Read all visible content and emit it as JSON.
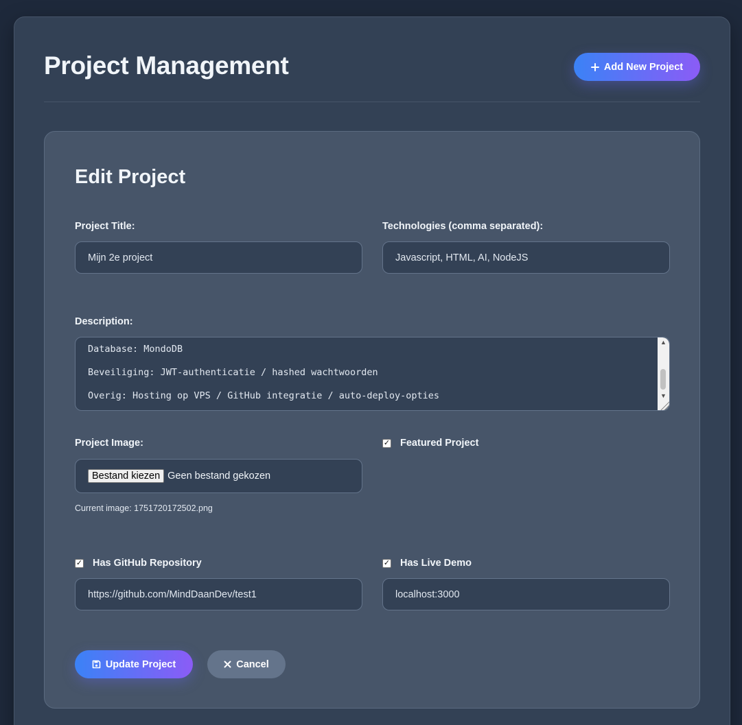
{
  "header": {
    "title": "Project Management",
    "add_button_label": "Add New Project"
  },
  "form": {
    "title": "Edit Project",
    "project_title_label": "Project Title:",
    "project_title_value": "Mijn 2e project",
    "technologies_label": "Technologies (comma separated):",
    "technologies_value": "Javascript, HTML, AI, NodeJS",
    "description_label": "Description:",
    "description_lines": [
      "Database: MondoDB",
      "Beveiliging: JWT-authenticatie / hashed wachtwoorden",
      "Overig: Hosting op VPS / GitHub integratie / auto-deploy-opties"
    ],
    "image_label": "Project Image:",
    "file_button_label": "Bestand kiezen",
    "file_status": "Geen bestand gekozen",
    "current_image": "Current image: 1751720172502.png",
    "featured_label": "Featured Project",
    "featured_checked": true,
    "github_label": "Has GitHub Repository",
    "github_checked": true,
    "github_value": "https://github.com/MindDaanDev/test1",
    "live_demo_label": "Has Live Demo",
    "live_demo_checked": true,
    "live_demo_value": "localhost:3000",
    "update_button_label": "Update Project",
    "cancel_button_label": "Cancel"
  },
  "colors": {
    "page_bg": "#1e293b",
    "panel_bg": "#334155",
    "card_bg": "#475569",
    "gradient_start": "#3b82f6",
    "gradient_end": "#8b5cf6",
    "cancel_bg": "#64748b"
  },
  "icons": {
    "add": "plus-icon",
    "update": "floppy-disk-icon",
    "cancel": "x-icon"
  }
}
